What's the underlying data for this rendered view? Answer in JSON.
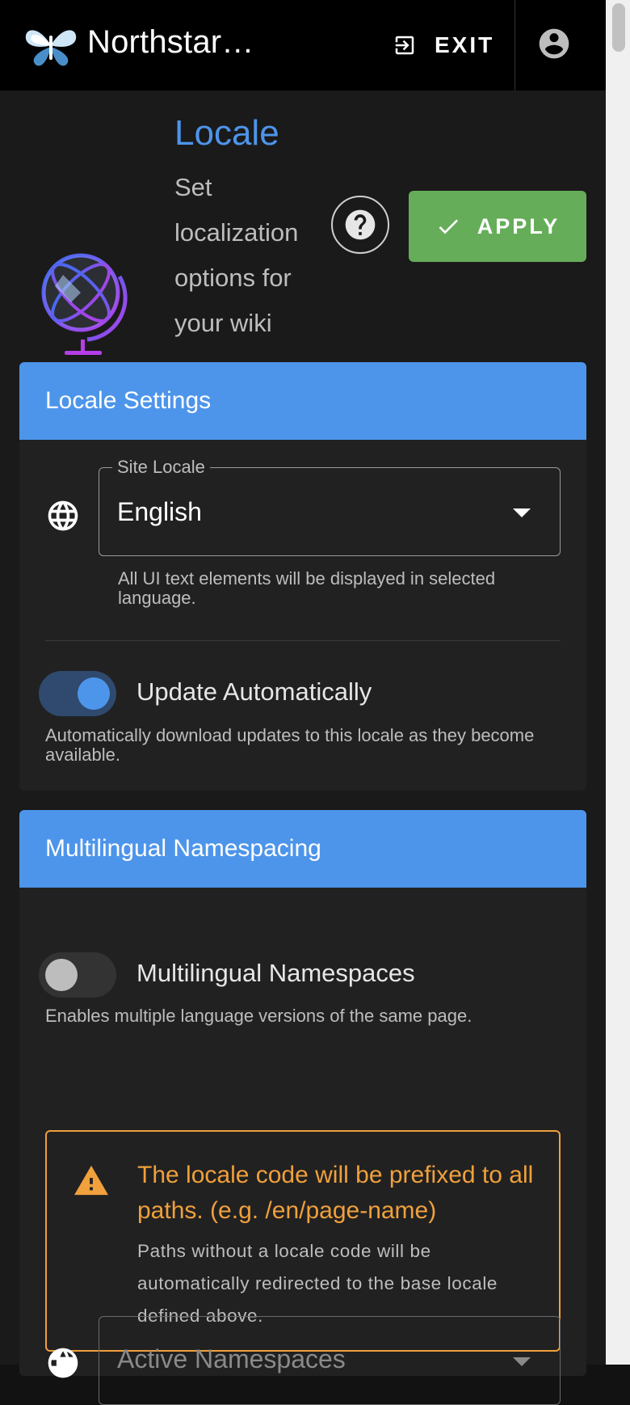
{
  "appbar": {
    "title": "Northstar…",
    "exit_label": "EXIT"
  },
  "header": {
    "title": "Locale",
    "subtitle": "Set localization options for your wiki",
    "apply_label": "APPLY"
  },
  "locale_settings": {
    "title": "Locale Settings",
    "site_locale": {
      "label": "Site Locale",
      "value": "English",
      "hint": "All UI text elements will be displayed in selected language."
    },
    "update_auto": {
      "label": "Update Automatically",
      "enabled": true,
      "hint": "Automatically download updates to this locale as they be­come available."
    }
  },
  "namespacing": {
    "title": "Multilingual Namespacing",
    "toggle": {
      "label": "Multilingual Namespaces",
      "enabled": false,
      "hint": "Enables multiple language versions of the same page."
    },
    "alert": {
      "title": "The locale code will be prefixed to all paths. (e.g. /en/page-name)",
      "text": "Paths without a locale code will be automatically redirected to the base locale defined above."
    },
    "active_namespaces": {
      "label": "Active Namespaces"
    }
  },
  "colors": {
    "accent": "#4d95ea",
    "apply": "#66ad5a",
    "warning": "#f0a03c"
  }
}
